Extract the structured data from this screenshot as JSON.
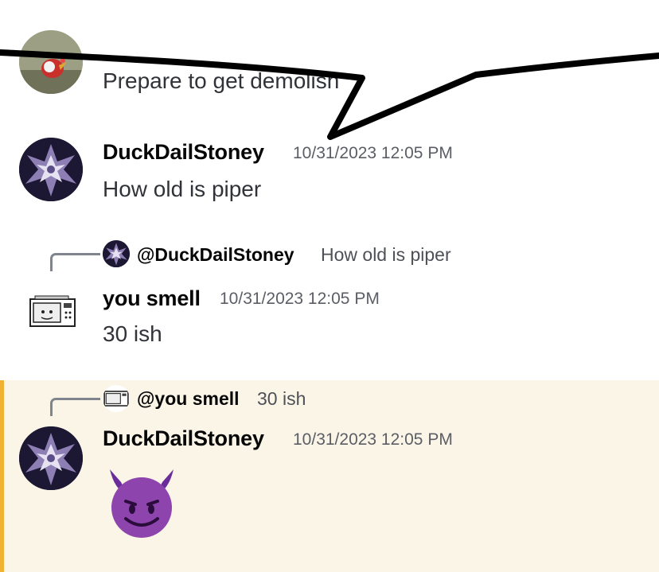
{
  "messages": [
    {
      "text": "Prepare to get demolish",
      "avatar_icon": "chicken-avatar-icon"
    },
    {
      "username": "DuckDailStoney",
      "timestamp": "10/31/2023 12:05 PM",
      "text": "How old is piper",
      "avatar_icon": "dragon-avatar-icon"
    },
    {
      "reply": {
        "username": "@DuckDailStoney",
        "text": "How old is piper"
      },
      "username": "you smell",
      "timestamp": "10/31/2023 12:05 PM",
      "text": "30 ish",
      "avatar_icon": "microwave-avatar-icon"
    },
    {
      "reply": {
        "username": "@you smell",
        "text": "30 ish"
      },
      "username": "DuckDailStoney",
      "timestamp": "10/31/2023 12:05 PM",
      "emoji": "😈",
      "avatar_icon": "dragon-avatar-icon",
      "highlighted": true
    }
  ],
  "colors": {
    "highlight_bg": "#faf5e7",
    "highlight_bar": "#f0b232",
    "annotation_stroke": "#000000"
  }
}
